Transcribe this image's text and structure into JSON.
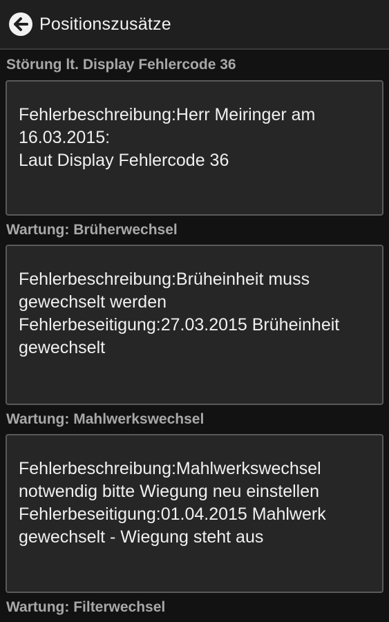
{
  "header": {
    "title": "Positionszusätze"
  },
  "sections": [
    {
      "title": "Störung lt. Display Fehlercode 36",
      "text": "Fehlerbeschreibung:Herr Meiringer am 16.03.2015:\nLaut Display Fehlercode 36"
    },
    {
      "title": "Wartung: Brüherwechsel",
      "text": "Fehlerbeschreibung:Brüheinheit muss gewechselt werden\nFehlerbeseitigung:27.03.2015 Brüheinheit gewechselt"
    },
    {
      "title": "Wartung: Mahlwerkswechsel",
      "text": "Fehlerbeschreibung:Mahlwerkswechsel notwendig bitte Wiegung neu einstellen\nFehlerbeseitigung:01.04.2015 Mahlwerk gewechselt - Wiegung steht aus"
    },
    {
      "title": "Wartung: Filterwechsel",
      "text": ""
    }
  ],
  "colors": {
    "background": "#121212",
    "action_bar": "#1f1f1f",
    "section_header_text": "#a8a8a8",
    "box_background": "#262626",
    "box_border": "#5a5a5a",
    "text": "#f0f0f0"
  },
  "icons": {
    "back": "arrow-left-circle-icon"
  }
}
